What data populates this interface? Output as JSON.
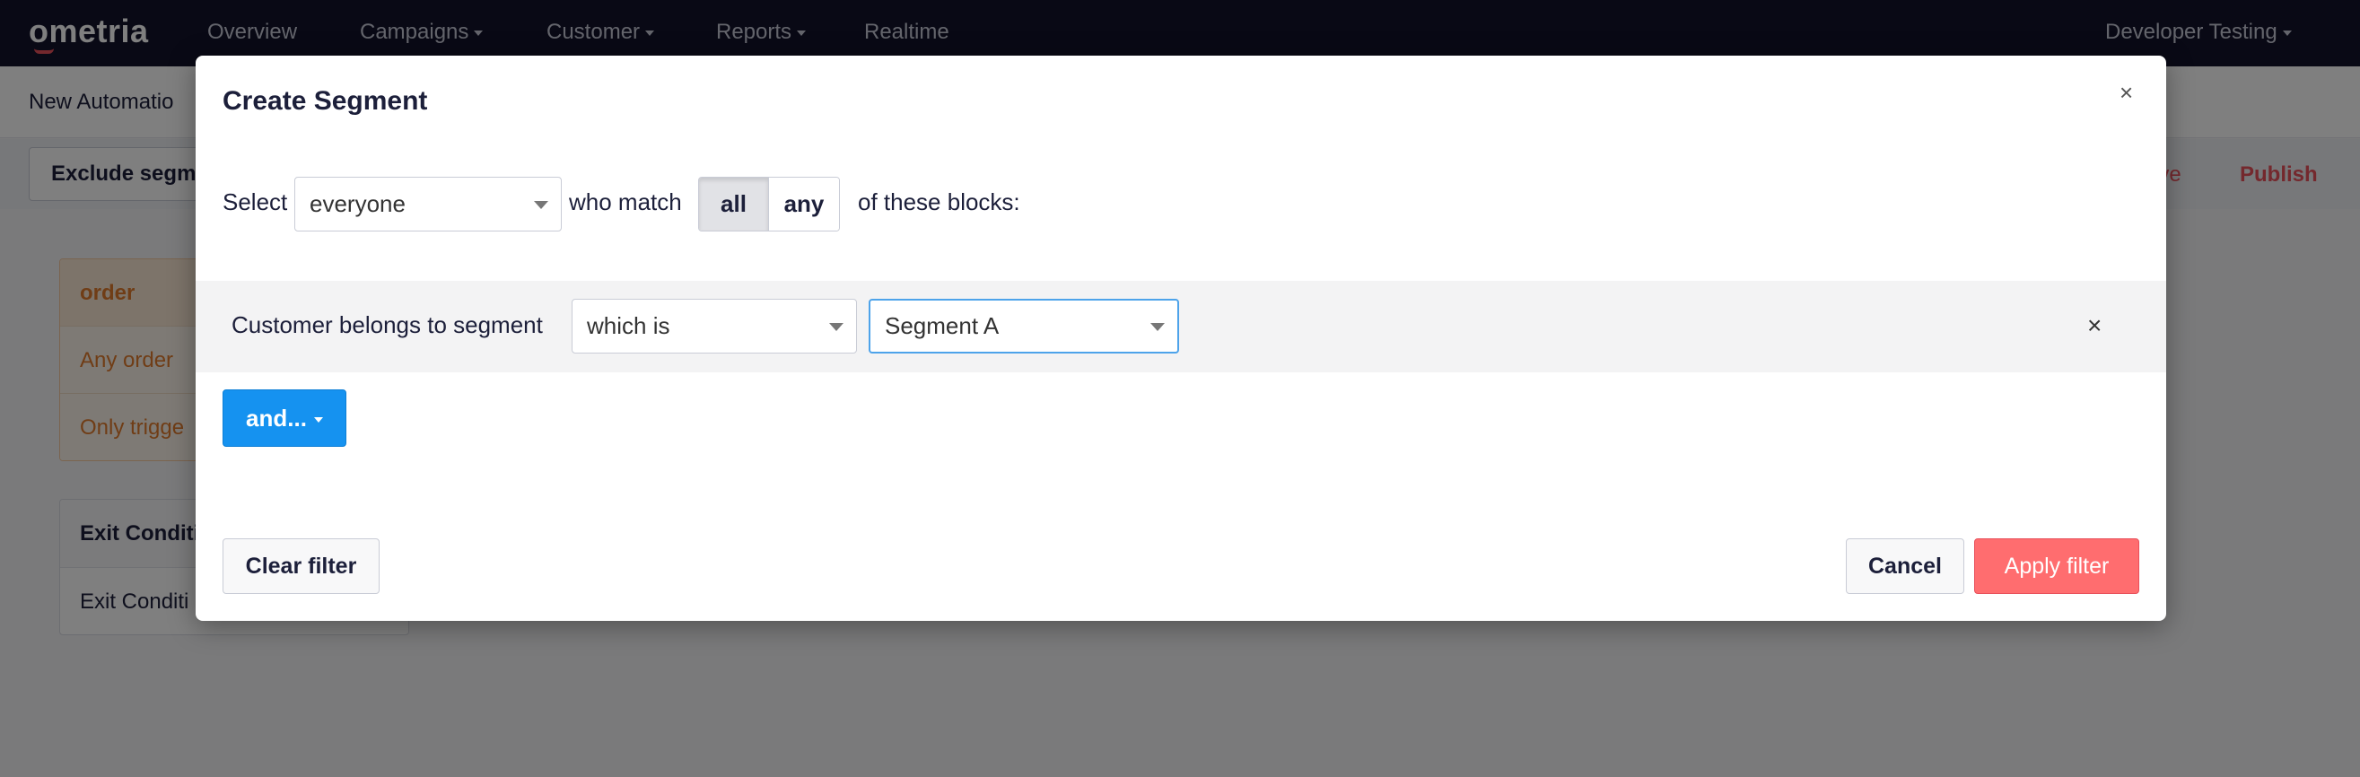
{
  "nav": {
    "logo": "ometria",
    "items": [
      {
        "label": "Overview",
        "dropdown": false
      },
      {
        "label": "Campaigns",
        "dropdown": true
      },
      {
        "label": "Customer",
        "dropdown": true
      },
      {
        "label": "Reports",
        "dropdown": true
      },
      {
        "label": "Realtime",
        "dropdown": false
      }
    ],
    "account": "Developer Testing"
  },
  "page": {
    "title": "New Automatio",
    "exclude_button": "Exclude segm",
    "save_label": "ave",
    "publish_label": "Publish",
    "order_card": {
      "header": "order",
      "rows": [
        "Any order",
        "Only trigge"
      ]
    },
    "exit_card": {
      "header": "Exit Conditi",
      "rows": [
        "Exit Conditi"
      ]
    }
  },
  "modal": {
    "title": "Create Segment",
    "close_icon": "×",
    "select_label": "Select",
    "audience_value": "everyone",
    "who_match": "who match",
    "match_options": [
      "all",
      "any"
    ],
    "match_selected": "all",
    "of_these_blocks": "of these blocks:",
    "block": {
      "label": "Customer belongs to segment",
      "operator": "which is",
      "segment": "Segment A",
      "remove_icon": "×"
    },
    "and_button": "and...",
    "clear_filter": "Clear filter",
    "cancel": "Cancel",
    "apply_filter": "Apply filter"
  },
  "colors": {
    "nav_bg": "#12132b",
    "primary_blue": "#1592f0",
    "apply_red": "#ff6d6f",
    "accent_orange": "#e07b2c"
  }
}
